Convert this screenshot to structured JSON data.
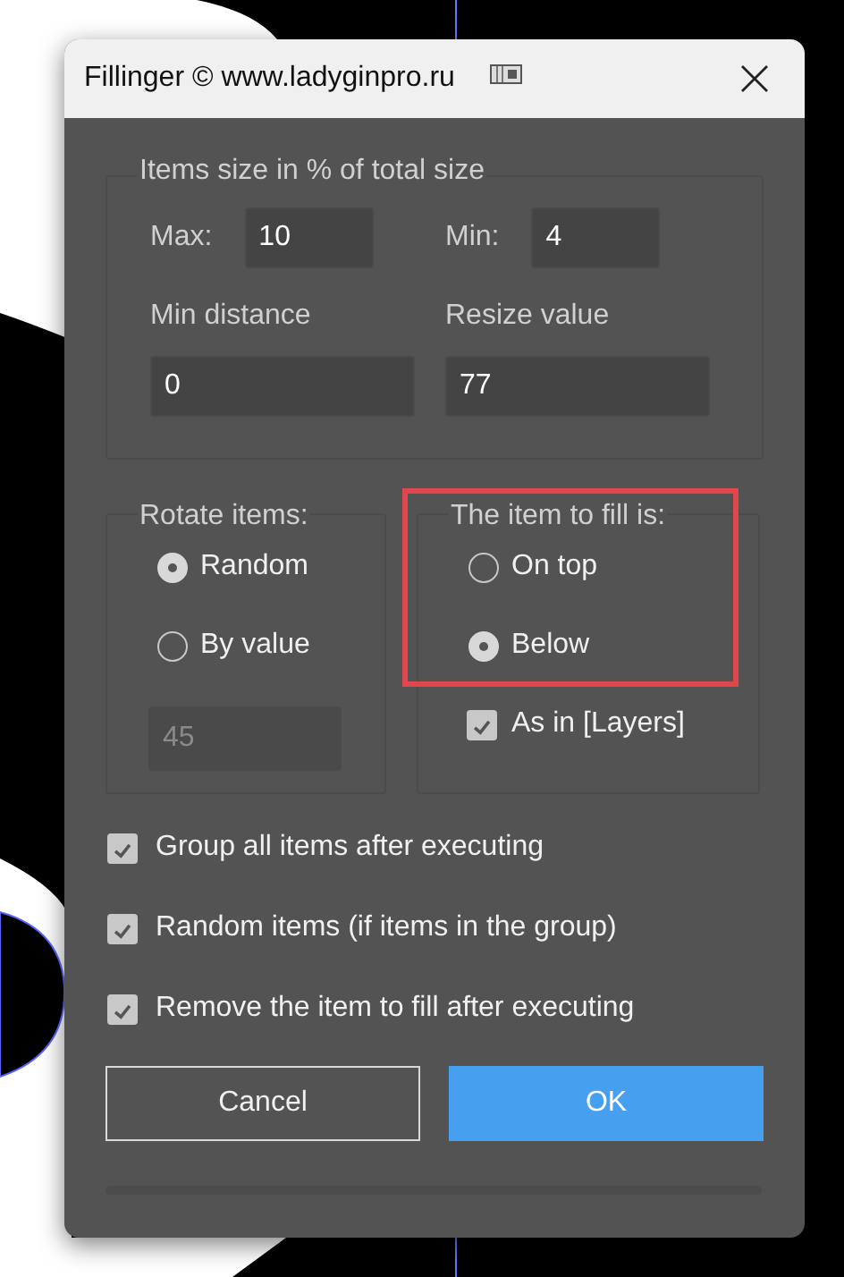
{
  "window": {
    "title": "Fillinger © www.ladyginpro.ru"
  },
  "size_group": {
    "title": "Items size in % of total size",
    "fields": [
      {
        "kind": "inline",
        "label": "Max:",
        "value": "10"
      },
      {
        "kind": "inline",
        "label": "Min:",
        "value": "4"
      },
      {
        "kind": "stacked",
        "label": "Min distance",
        "value": "0"
      },
      {
        "kind": "stacked",
        "label": "Resize value",
        "value": "77"
      }
    ]
  },
  "rotate_group": {
    "title": "Rotate items:",
    "options": [
      {
        "label": "Random",
        "selected": true
      },
      {
        "label": "By value",
        "selected": false
      }
    ],
    "angle_field": {
      "value": "45",
      "disabled": true
    }
  },
  "fill_group": {
    "title": "The item to fill is:",
    "highlighted": true,
    "options": [
      {
        "label": "On top",
        "selected": false
      },
      {
        "label": "Below",
        "selected": true
      }
    ],
    "checkbox": {
      "label": "As in [Layers]",
      "checked": true
    }
  },
  "options": [
    {
      "label": "Group all items after executing",
      "checked": true
    },
    {
      "label": "Random items (if items in the group)",
      "checked": true
    },
    {
      "label": "Remove the item to fill after executing",
      "checked": true
    }
  ],
  "buttons": [
    {
      "label": "Cancel",
      "kind": "secondary"
    },
    {
      "label": "OK",
      "kind": "primary"
    }
  ]
}
